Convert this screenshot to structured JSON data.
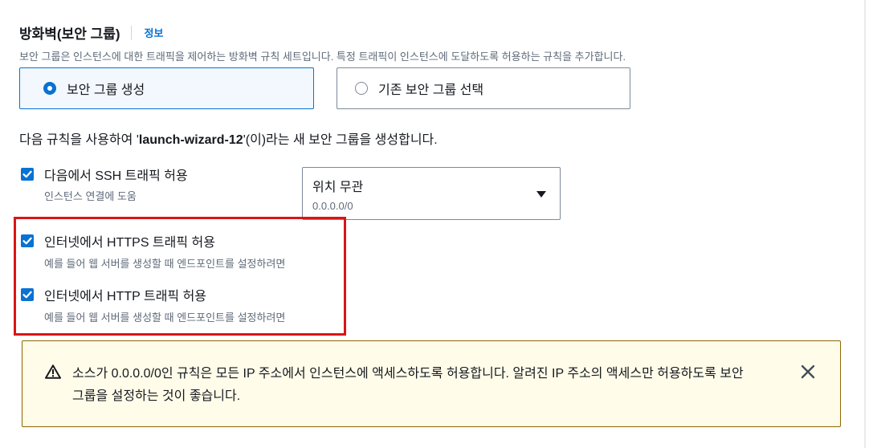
{
  "section": {
    "title": "방화벽(보안 그룹)",
    "info_link": "정보",
    "description": "보안 그룹은 인스턴스에 대한 트래픽을 제어하는 방화벽 규칙 세트입니다. 특정 트래픽이 인스턴스에 도달하도록 허용하는 규칙을 추가합니다."
  },
  "radio": {
    "create_label": "보안 그룹 생성",
    "existing_label": "기존 보안 그룹 선택",
    "selected": "create"
  },
  "create_text": {
    "prefix": "다음 규칙을 사용하여 '",
    "group_name": "launch-wizard-12",
    "suffix": "'(이)라는 새 보안 그룹을 생성합니다."
  },
  "rules": {
    "ssh": {
      "label": "다음에서 SSH 트래픽 허용",
      "sub": "인스턴스 연결에 도움",
      "checked": true
    },
    "https": {
      "label": "인터넷에서 HTTPS 트래픽 허용",
      "sub": "예를 들어 웹 서버를 생성할 때 엔드포인트를 설정하려면",
      "checked": true
    },
    "http": {
      "label": "인터넷에서 HTTP 트래픽 허용",
      "sub": "예를 들어 웹 서버를 생성할 때 엔드포인트를 설정하려면",
      "checked": true
    }
  },
  "ssh_source_select": {
    "value": "위치 무관",
    "sub": "0.0.0.0/0"
  },
  "alert": {
    "text": "소스가 0.0.0.0/0인 규칙은 모든 IP 주소에서 인스턴스에 액세스하도록 허용합니다. 알려진 IP 주소의 액세스만 허용하도록 보안 그룹을 설정하는 것이 좋습니다.",
    "icon": "warning-icon",
    "close_icon": "close-icon"
  },
  "colors": {
    "accent": "#0972d3",
    "highlight": "#d91515",
    "warning_bg": "#fffce9",
    "warning_border": "#8d6605"
  }
}
